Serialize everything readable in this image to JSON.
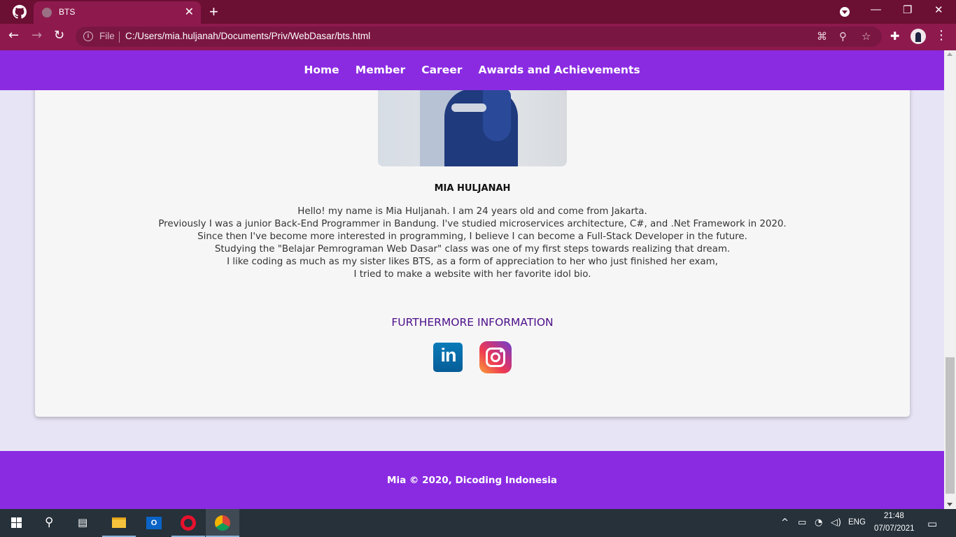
{
  "browser": {
    "tab_title": "BTS",
    "tab_close": "✕",
    "new_tab": "+",
    "back": "←",
    "forward": "→",
    "reload": "↻",
    "file_label": "File",
    "url": "C:/Users/mia.huljanah/Documents/Priv/WebDasar/bts.html",
    "window_controls": {
      "minimize": "—",
      "restore": "❐",
      "close": "✕"
    }
  },
  "site": {
    "nav": [
      {
        "label": "Home"
      },
      {
        "label": "Member"
      },
      {
        "label": "Career"
      },
      {
        "label": "Awards and Achievements"
      }
    ],
    "profile": {
      "name": "MIA HULJANAH",
      "bio_lines": [
        "Hello! my name is Mia Huljanah. I am 24 years old and come from Jakarta.",
        "Previously I was a junior Back-End Programmer in Bandung. I've studied microservices architecture, C#, and .Net Framework in 2020.",
        "Since then I've become more interested in programming, I believe I can become a Full-Stack Developer in the future.",
        "Studying the \"Belajar Pemrograman Web Dasar\" class was one of my first steps towards realizing that dream.",
        "I like coding as much as my sister likes BTS, as a form of appreciation to her who just finished her exam,",
        "I tried to make a website with her favorite idol bio."
      ]
    },
    "further_title": "FURTHERMORE INFORMATION",
    "socials": [
      {
        "icon": "linkedin-icon",
        "text": "in"
      },
      {
        "icon": "instagram-icon"
      }
    ],
    "footer": "Mia © 2020, Dicoding Indonesia"
  },
  "taskbar": {
    "language": "ENG",
    "time": "21:48",
    "date": "07/07/2021"
  },
  "colors": {
    "nav_bg": "#8a2be2",
    "page_bg": "#e7e4f6",
    "browser_frame": "#6b0f33",
    "heading_accent": "#4b0f8a"
  }
}
